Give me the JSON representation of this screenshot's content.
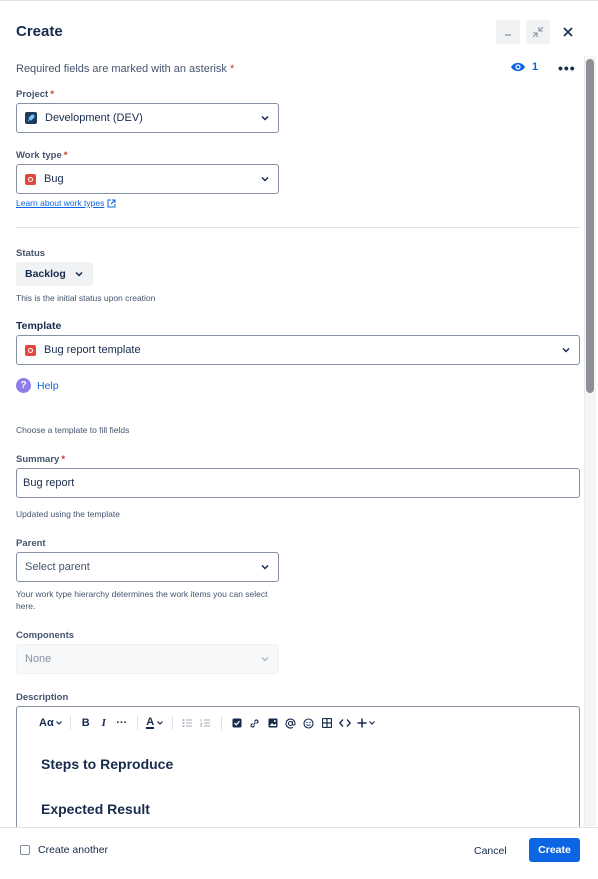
{
  "header": {
    "title": "Create",
    "required_note": "Required fields are marked with an asterisk",
    "required_star": "*",
    "watch_count": "1",
    "more_label": "•••"
  },
  "fields": {
    "project": {
      "label": "Project",
      "value": "Development (DEV)"
    },
    "work_type": {
      "label": "Work type",
      "value": "Bug",
      "link": "Learn about work types"
    },
    "status": {
      "label": "Status",
      "value": "Backlog",
      "help": "This is the initial status upon creation"
    },
    "template": {
      "label": "Template",
      "value": "Bug report template",
      "help_link": "Help",
      "help": "Choose a template to fill fields"
    },
    "summary": {
      "label": "Summary",
      "value": "Bug report",
      "help": "Updated using the template"
    },
    "parent": {
      "label": "Parent",
      "placeholder": "Select parent",
      "help": "Your work type hierarchy determines the work items you can select here."
    },
    "components": {
      "label": "Components",
      "placeholder": "None"
    },
    "description": {
      "label": "Description",
      "toolbar": {
        "text_style": "Aα",
        "bold": "B",
        "italic": "I",
        "more": "···",
        "color": "A"
      },
      "headings": [
        "Steps to Reproduce",
        "Expected Result"
      ]
    }
  },
  "footer": {
    "create_another": "Create another",
    "cancel": "Cancel",
    "create": "Create"
  },
  "colors": {
    "primary": "#0c66e4",
    "required": "#c9372c",
    "bug": "#e2483d",
    "help": "#8f7ee7"
  }
}
